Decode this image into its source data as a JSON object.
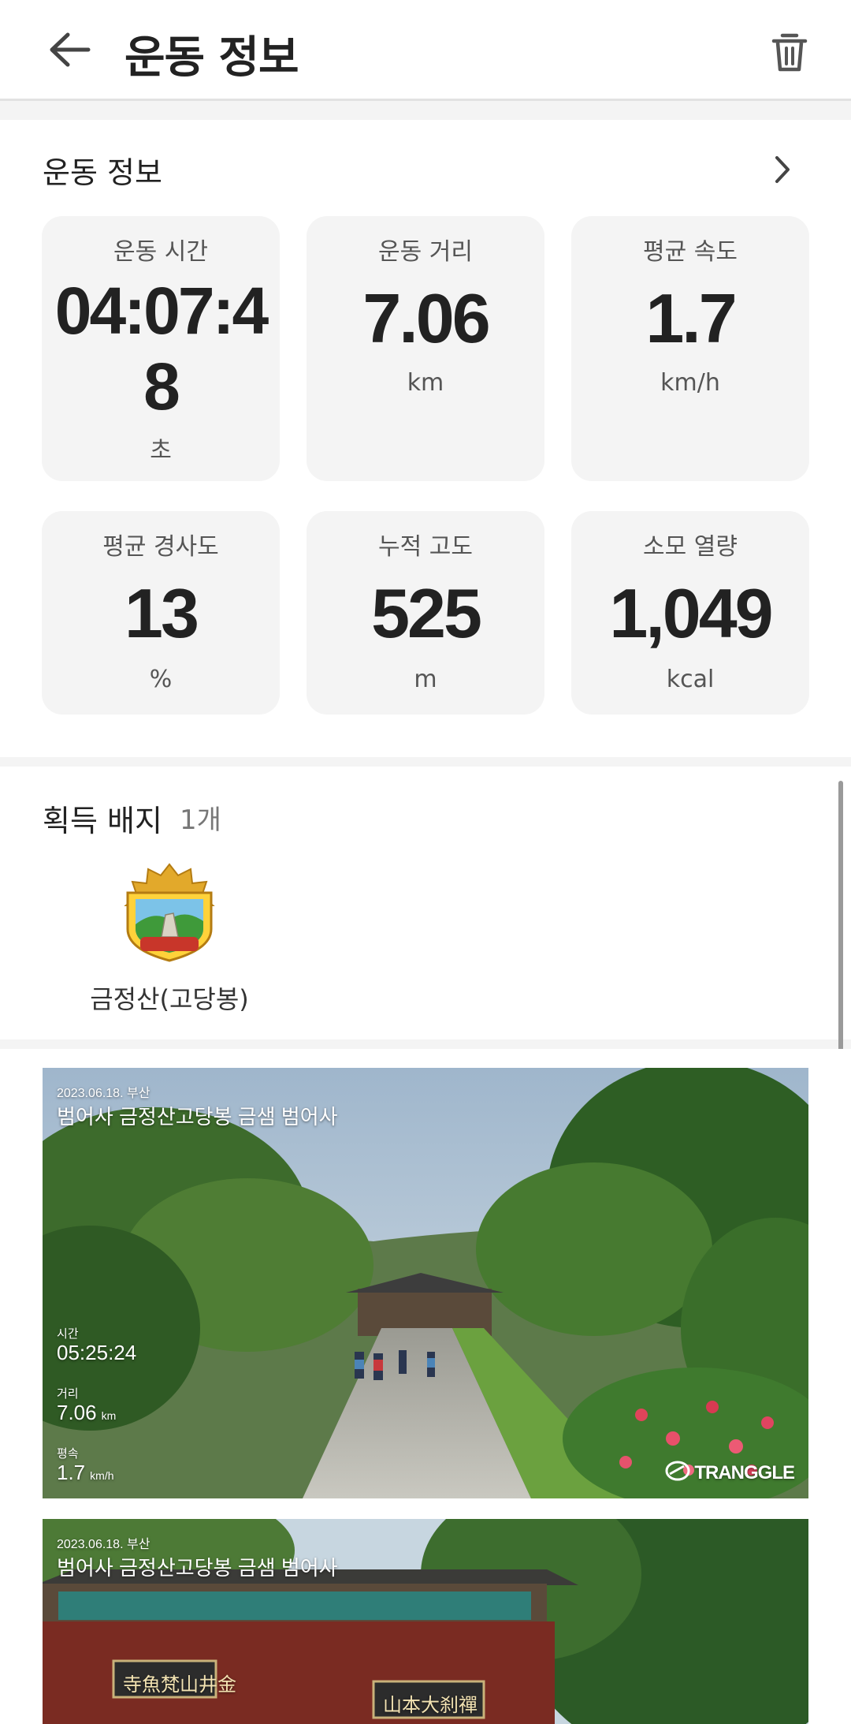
{
  "header": {
    "title": "운동 정보",
    "back_icon": "arrow-left-icon",
    "delete_icon": "trash-icon"
  },
  "info": {
    "title": "운동 정보",
    "stats": [
      {
        "label": "운동 시간",
        "value_line1": "04:07:4",
        "value_line2": "8",
        "unit": "초"
      },
      {
        "label": "운동 거리",
        "value": "7.06",
        "unit": "km"
      },
      {
        "label": "평균 속도",
        "value": "1.7",
        "unit": "km/h"
      },
      {
        "label": "평균 경사도",
        "value": "13",
        "unit": "%"
      },
      {
        "label": "누적 고도",
        "value": "525",
        "unit": "m"
      },
      {
        "label": "소모 열량",
        "value": "1,049",
        "unit": "kcal"
      }
    ]
  },
  "badges": {
    "title": "획득 배지",
    "count": "1개",
    "items": [
      {
        "name": "금정산(고당봉)",
        "emblem_text": "금정산(고당봉)"
      }
    ]
  },
  "photos": [
    {
      "date": "2023.06.18. 부산",
      "title": "범어사 금정산고당봉 금샘 범어사",
      "time_label": "시간",
      "time_value": "05:25:24",
      "dist_label": "거리",
      "dist_value": "7.06",
      "dist_unit": "km",
      "speed_label": "평속",
      "speed_value": "1.7",
      "speed_unit": "km/h",
      "logo": "TRANGGLE"
    },
    {
      "date": "2023.06.18. 부산",
      "title": "범어사 금정산고당봉 금샘 범어사",
      "sign_left": "寺魚梵山井金",
      "sign_right": "山本大刹禪"
    }
  ]
}
